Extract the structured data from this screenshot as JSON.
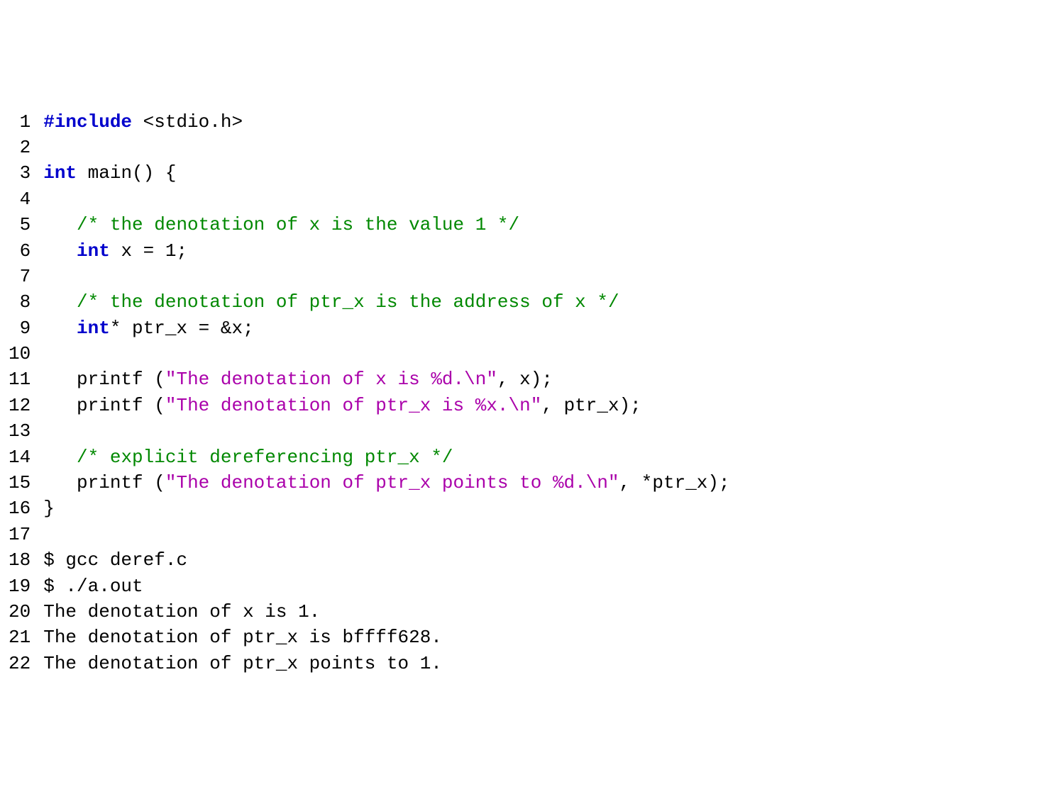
{
  "lines": [
    {
      "n": "1",
      "segments": [
        {
          "cls": "pp",
          "t": "#include"
        },
        {
          "cls": "plain",
          "t": " <stdio.h>"
        }
      ]
    },
    {
      "n": "2",
      "segments": []
    },
    {
      "n": "3",
      "segments": [
        {
          "cls": "kw",
          "t": "int"
        },
        {
          "cls": "plain",
          "t": " main() {"
        }
      ]
    },
    {
      "n": "4",
      "segments": []
    },
    {
      "n": "5",
      "segments": [
        {
          "cls": "plain",
          "t": "   "
        },
        {
          "cls": "cm",
          "t": "/* the denotation of x is the value 1 */"
        }
      ]
    },
    {
      "n": "6",
      "segments": [
        {
          "cls": "plain",
          "t": "   "
        },
        {
          "cls": "kw",
          "t": "int"
        },
        {
          "cls": "plain",
          "t": " x = 1;"
        }
      ]
    },
    {
      "n": "7",
      "segments": []
    },
    {
      "n": "8",
      "segments": [
        {
          "cls": "plain",
          "t": "   "
        },
        {
          "cls": "cm",
          "t": "/* the denotation of ptr_x is the address of x */"
        }
      ]
    },
    {
      "n": "9",
      "segments": [
        {
          "cls": "plain",
          "t": "   "
        },
        {
          "cls": "kw",
          "t": "int"
        },
        {
          "cls": "plain",
          "t": "* ptr_x = &x;"
        }
      ]
    },
    {
      "n": "10",
      "segments": []
    },
    {
      "n": "11",
      "segments": [
        {
          "cls": "plain",
          "t": "   printf ("
        },
        {
          "cls": "str",
          "t": "\"The denotation of x is %d.\\n\""
        },
        {
          "cls": "plain",
          "t": ", x);"
        }
      ]
    },
    {
      "n": "12",
      "segments": [
        {
          "cls": "plain",
          "t": "   printf ("
        },
        {
          "cls": "str",
          "t": "\"The denotation of ptr_x is %x.\\n\""
        },
        {
          "cls": "plain",
          "t": ", ptr_x);"
        }
      ]
    },
    {
      "n": "13",
      "segments": []
    },
    {
      "n": "14",
      "segments": [
        {
          "cls": "plain",
          "t": "   "
        },
        {
          "cls": "cm",
          "t": "/* explicit dereferencing ptr_x */"
        }
      ]
    },
    {
      "n": "15",
      "segments": [
        {
          "cls": "plain",
          "t": "   printf ("
        },
        {
          "cls": "str",
          "t": "\"The denotation of ptr_x points to %d.\\n\""
        },
        {
          "cls": "plain",
          "t": ", *ptr_x);"
        }
      ]
    },
    {
      "n": "16",
      "segments": [
        {
          "cls": "plain",
          "t": "}"
        }
      ]
    },
    {
      "n": "17",
      "segments": []
    },
    {
      "n": "18",
      "segments": [
        {
          "cls": "plain",
          "t": "$ gcc deref.c"
        }
      ]
    },
    {
      "n": "19",
      "segments": [
        {
          "cls": "plain",
          "t": "$ ./a.out"
        }
      ]
    },
    {
      "n": "20",
      "segments": [
        {
          "cls": "plain",
          "t": "The denotation of x is 1."
        }
      ]
    },
    {
      "n": "21",
      "segments": [
        {
          "cls": "plain",
          "t": "The denotation of ptr_x is bffff628."
        }
      ]
    },
    {
      "n": "22",
      "segments": [
        {
          "cls": "plain",
          "t": "The denotation of ptr_x points to 1."
        }
      ]
    }
  ]
}
